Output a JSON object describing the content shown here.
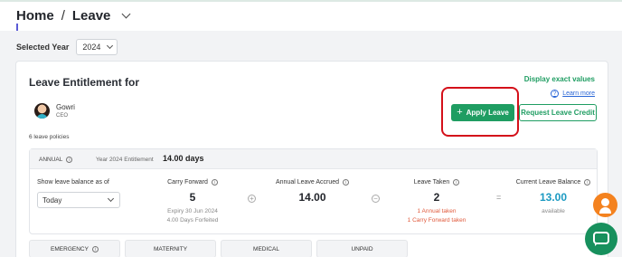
{
  "breadcrumb": {
    "home": "Home",
    "separator": "/",
    "current": "Leave"
  },
  "year_filter": {
    "label": "Selected Year",
    "value": "2024"
  },
  "card": {
    "title": "Leave Entitlement for",
    "display_exact": "Display exact values",
    "learn_more": "Learn more",
    "employee": {
      "name": "Gowri",
      "role": "CEO"
    },
    "apply_label": "Apply Leave",
    "request_credit_label": "Request Leave Credit",
    "policies_count": "6 leave policies"
  },
  "policy": {
    "name": "ANNUAL",
    "entitlement_label": "Year 2024 Entitlement",
    "entitlement_value": "14.00 days",
    "balance_as_of_label": "Show leave balance as of",
    "balance_as_of_value": "Today",
    "carry_forward": {
      "label": "Carry Forward",
      "value": "5",
      "sub1": "Expiry 30 Jun 2024",
      "sub2": "4.00 Days Forfeited"
    },
    "accrued": {
      "label": "Annual Leave Accrued",
      "value": "14.00"
    },
    "taken": {
      "label": "Leave Taken",
      "value": "2",
      "sub1": "1 Annual taken",
      "sub2": "1 Carry Forward taken"
    },
    "balance": {
      "label": "Current Leave Balance",
      "value": "13.00",
      "sub": "available"
    },
    "operators": {
      "plus": "+",
      "minus": "−",
      "equals": "="
    }
  },
  "tabs": [
    "EMERGENCY",
    "MATERNITY",
    "MEDICAL",
    "UNPAID"
  ],
  "colors": {
    "primary": "#1f9d62",
    "highlight": "#d4101a",
    "balance": "#1b9ac2",
    "taken_sub": "#e05a3c",
    "fab_user": "#f4821f"
  },
  "icons": [
    "chevron-down-icon",
    "info-icon",
    "help-icon",
    "plus-icon",
    "user-support-icon",
    "chat-icon"
  ]
}
